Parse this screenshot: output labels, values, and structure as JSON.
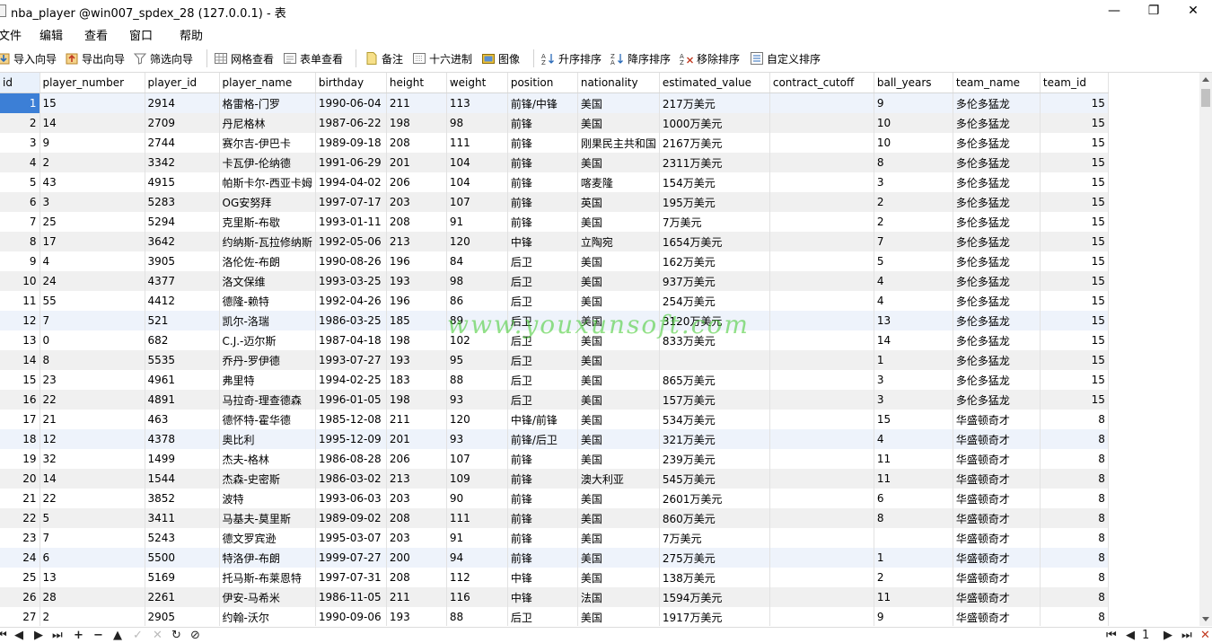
{
  "window": {
    "title": "nba_player @win007_spdex_28 (127.0.0.1) - 表",
    "minimize": "—",
    "restore": "❐",
    "close": "✕"
  },
  "menu": [
    "文件",
    "编辑",
    "查看",
    "窗口",
    "帮助"
  ],
  "toolbar": {
    "import_label": "导入向导",
    "export_label": "导出向导",
    "filter_label": "筛选向导",
    "grid_view_label": "网格查看",
    "form_view_label": "表单查看",
    "memo_label": "备注",
    "hex_label": "十六进制",
    "image_label": "图像",
    "sort_asc_label": "升序排序",
    "sort_desc_label": "降序排序",
    "remove_sort_label": "移除排序",
    "custom_sort_label": "自定义排序"
  },
  "columns": [
    "id",
    "player_number",
    "player_id",
    "player_name",
    "birthday",
    "height",
    "weight",
    "position",
    "nationality",
    "estimated_value",
    "contract_cutoff",
    "ball_years",
    "team_name",
    "team_id"
  ],
  "rows": [
    [
      "1",
      "15",
      "2914",
      "格雷格-门罗",
      "1990-06-04",
      "211",
      "113",
      "前锋/中锋",
      "美国",
      "217万美元",
      "",
      "9",
      "多伦多猛龙",
      "15"
    ],
    [
      "2",
      "14",
      "2709",
      "丹尼格林",
      "1987-06-22",
      "198",
      "98",
      "前锋",
      "美国",
      "1000万美元",
      "",
      "10",
      "多伦多猛龙",
      "15"
    ],
    [
      "3",
      "9",
      "2744",
      "赛尔吉-伊巴卡",
      "1989-09-18",
      "208",
      "111",
      "前锋",
      "刚果民主共和国",
      "2167万美元",
      "",
      "10",
      "多伦多猛龙",
      "15"
    ],
    [
      "4",
      "2",
      "3342",
      "卡瓦伊-伦纳德",
      "1991-06-29",
      "201",
      "104",
      "前锋",
      "美国",
      "2311万美元",
      "",
      "8",
      "多伦多猛龙",
      "15"
    ],
    [
      "5",
      "43",
      "4915",
      "帕斯卡尔-西亚卡姆",
      "1994-04-02",
      "206",
      "104",
      "前锋",
      "喀麦隆",
      "154万美元",
      "",
      "3",
      "多伦多猛龙",
      "15"
    ],
    [
      "6",
      "3",
      "5283",
      "OG安努拜",
      "1997-07-17",
      "203",
      "107",
      "前锋",
      "英国",
      "195万美元",
      "",
      "2",
      "多伦多猛龙",
      "15"
    ],
    [
      "7",
      "25",
      "5294",
      "克里斯-布歇",
      "1993-01-11",
      "208",
      "91",
      "前锋",
      "美国",
      "7万美元",
      "",
      "2",
      "多伦多猛龙",
      "15"
    ],
    [
      "8",
      "17",
      "3642",
      "约纳斯-瓦拉修纳斯",
      "1992-05-06",
      "213",
      "120",
      "中锋",
      "立陶宛",
      "1654万美元",
      "",
      "7",
      "多伦多猛龙",
      "15"
    ],
    [
      "9",
      "4",
      "3905",
      "洛伦佐-布朗",
      "1990-08-26",
      "196",
      "84",
      "后卫",
      "美国",
      "162万美元",
      "",
      "5",
      "多伦多猛龙",
      "15"
    ],
    [
      "10",
      "24",
      "4377",
      "洛文保维",
      "1993-03-25",
      "193",
      "98",
      "后卫",
      "美国",
      "937万美元",
      "",
      "4",
      "多伦多猛龙",
      "15"
    ],
    [
      "11",
      "55",
      "4412",
      "德隆-赖特",
      "1992-04-26",
      "196",
      "86",
      "后卫",
      "美国",
      "254万美元",
      "",
      "4",
      "多伦多猛龙",
      "15"
    ],
    [
      "12",
      "7",
      "521",
      "凯尔-洛瑞",
      "1986-03-25",
      "185",
      "89",
      "后卫",
      "美国",
      "3120万美元",
      "",
      "13",
      "多伦多猛龙",
      "15"
    ],
    [
      "13",
      "0",
      "682",
      "C.J.-迈尔斯",
      "1987-04-18",
      "198",
      "102",
      "后卫",
      "美国",
      "833万美元",
      "",
      "14",
      "多伦多猛龙",
      "15"
    ],
    [
      "14",
      "8",
      "5535",
      "乔丹-罗伊德",
      "1993-07-27",
      "193",
      "95",
      "后卫",
      "美国",
      "",
      "",
      "1",
      "多伦多猛龙",
      "15"
    ],
    [
      "15",
      "23",
      "4961",
      "弗里特",
      "1994-02-25",
      "183",
      "88",
      "后卫",
      "美国",
      "865万美元",
      "",
      "3",
      "多伦多猛龙",
      "15"
    ],
    [
      "16",
      "22",
      "4891",
      "马拉奇-理查德森",
      "1996-01-05",
      "198",
      "93",
      "后卫",
      "美国",
      "157万美元",
      "",
      "3",
      "多伦多猛龙",
      "15"
    ],
    [
      "17",
      "21",
      "463",
      "德怀特-霍华德",
      "1985-12-08",
      "211",
      "120",
      "中锋/前锋",
      "美国",
      "534万美元",
      "",
      "15",
      "华盛顿奇才",
      "8"
    ],
    [
      "18",
      "12",
      "4378",
      "奥比利",
      "1995-12-09",
      "201",
      "93",
      "前锋/后卫",
      "美国",
      "321万美元",
      "",
      "4",
      "华盛顿奇才",
      "8"
    ],
    [
      "19",
      "32",
      "1499",
      "杰夫-格林",
      "1986-08-28",
      "206",
      "107",
      "前锋",
      "美国",
      "239万美元",
      "",
      "11",
      "华盛顿奇才",
      "8"
    ],
    [
      "20",
      "14",
      "1544",
      "杰森-史密斯",
      "1986-03-02",
      "213",
      "109",
      "前锋",
      "澳大利亚",
      "545万美元",
      "",
      "11",
      "华盛顿奇才",
      "8"
    ],
    [
      "21",
      "22",
      "3852",
      "波特",
      "1993-06-03",
      "203",
      "90",
      "前锋",
      "美国",
      "2601万美元",
      "",
      "6",
      "华盛顿奇才",
      "8"
    ],
    [
      "22",
      "5",
      "3411",
      "马基夫-莫里斯",
      "1989-09-02",
      "208",
      "111",
      "前锋",
      "美国",
      "860万美元",
      "",
      "8",
      "华盛顿奇才",
      "8"
    ],
    [
      "23",
      "7",
      "5243",
      "德文罗宾逊",
      "1995-03-07",
      "203",
      "91",
      "前锋",
      "美国",
      "7万美元",
      "",
      "",
      "华盛顿奇才",
      "8"
    ],
    [
      "24",
      "6",
      "5500",
      "特洛伊-布朗",
      "1999-07-27",
      "200",
      "94",
      "前锋",
      "美国",
      "275万美元",
      "",
      "1",
      "华盛顿奇才",
      "8"
    ],
    [
      "25",
      "13",
      "5169",
      "托马斯-布莱恩特",
      "1997-07-31",
      "208",
      "112",
      "中锋",
      "美国",
      "138万美元",
      "",
      "2",
      "华盛顿奇才",
      "8"
    ],
    [
      "26",
      "28",
      "2261",
      "伊安-马希米",
      "1986-11-05",
      "211",
      "116",
      "中锋",
      "法国",
      "1594万美元",
      "",
      "11",
      "华盛顿奇才",
      "8"
    ],
    [
      "27",
      "2",
      "2905",
      "约翰-沃尔",
      "1990-09-06",
      "193",
      "88",
      "后卫",
      "美国",
      "1917万美元",
      "",
      "9",
      "华盛顿奇才",
      "8"
    ]
  ],
  "watermark": "www.youxunsoft.com",
  "status": {
    "page": "1"
  }
}
